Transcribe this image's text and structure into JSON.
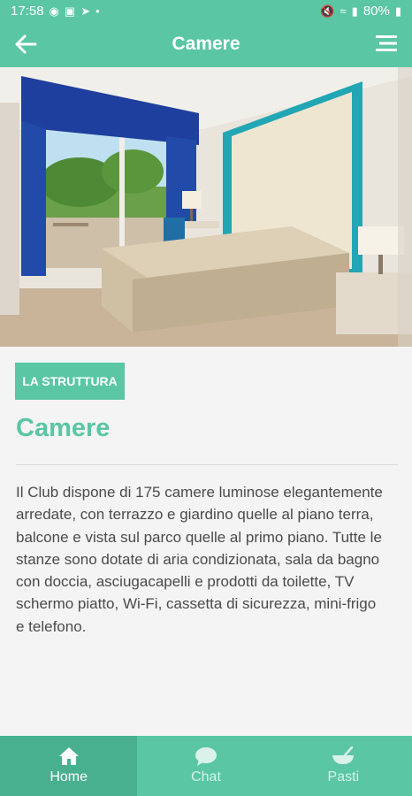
{
  "status": {
    "time": "17:58",
    "battery": "80%"
  },
  "header": {
    "title": "Camere"
  },
  "section": {
    "badge": "LA STRUTTURA",
    "title": "Camere",
    "description": "Il Club dispone di 175 camere luminose elegantemente arredate, con terrazzo e giardino quelle al piano terra, balcone e vista sul parco quelle al primo piano. Tutte le stanze sono dotate di aria condizionata, sala da bagno con doccia, asciugacapelli e prodotti da toilette, TV schermo piatto, Wi-Fi, cassetta di sicurezza, mini-frigo e telefono."
  },
  "nav": {
    "items": [
      {
        "label": "Home",
        "icon": "home-icon",
        "active": true
      },
      {
        "label": "Chat",
        "icon": "chat-icon",
        "active": false
      },
      {
        "label": "Pasti",
        "icon": "bowl-icon",
        "active": false
      }
    ]
  },
  "colors": {
    "accent": "#5ac6a4",
    "accent_dark": "#48b08f",
    "text": "#4a4a4a"
  }
}
